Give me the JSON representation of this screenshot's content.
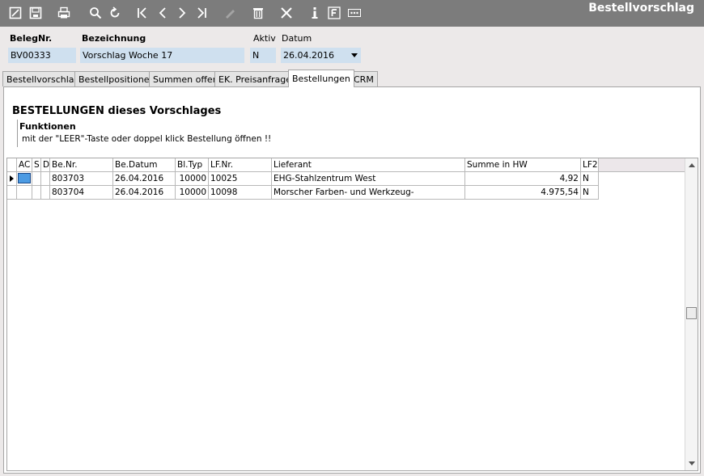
{
  "window": {
    "title": "Bestellvorschlag"
  },
  "toolbar": {
    "icons": [
      "edit-icon",
      "save-icon",
      "print-icon",
      "search-icon",
      "refresh-icon",
      "first-record-icon",
      "previous-record-icon",
      "next-record-icon",
      "last-record-icon",
      "disabled-pen-icon",
      "delete-icon",
      "close-icon",
      "info-icon",
      "f-icon",
      "more-icon"
    ]
  },
  "header": {
    "beleg_label": "BelegNr.",
    "beleg_value": "BV00333",
    "bez_label": "Bezeichnung",
    "bez_value": "Vorschlag Woche 17",
    "aktiv_label": "Aktiv",
    "aktiv_value": "N",
    "datum_label": "Datum",
    "datum_value": "26.04.2016"
  },
  "tabs": [
    "Bestellvorschlag",
    "Bestellpositionen",
    "Summen offen",
    "EK. Preisanfrage",
    "Bestellungen",
    "CRM"
  ],
  "active_tab": "Bestellungen",
  "section": {
    "title": "BESTELLUNGEN dieses Vorschlages",
    "func_title": "Funktionen",
    "func_text": "mit der \"LEER\"-Taste oder doppel klick Bestellung öffnen !!"
  },
  "grid": {
    "columns": [
      "AC",
      "S",
      "D",
      "Be.Nr.",
      "Be.Datum",
      "Bl.Typ",
      "LF.Nr.",
      "Lieferant",
      "Summe in HW",
      "LF2"
    ],
    "rows": [
      {
        "be_nr": "803703",
        "be_datum": "26.04.2016",
        "bl_typ": "10000",
        "lf_nr": "10025",
        "lieferant": "EHG-Stahlzentrum West",
        "summe": "4,92",
        "lf2": "N"
      },
      {
        "be_nr": "803704",
        "be_datum": "26.04.2016",
        "bl_typ": "10000",
        "lf_nr": "10098",
        "lieferant": "Morscher Farben- und Werkzeug-",
        "summe": "4.975,54",
        "lf2": "N"
      }
    ]
  },
  "colors": {
    "toolbar": "#7c7c7c",
    "field_bg": "#cfe0ef",
    "selection": "#4c9be3",
    "window_bg": "#ece9e9"
  }
}
